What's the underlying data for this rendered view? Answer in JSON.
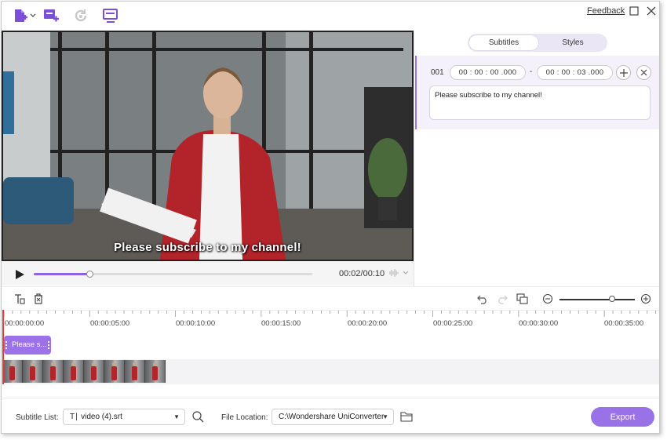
{
  "toolbar": {
    "icons": [
      "add-file-icon",
      "add-subtitle-icon",
      "refresh-icon",
      "screen-icon"
    ],
    "feedback_label": "Feedback"
  },
  "video": {
    "subtitle_text": "Please subscribe to my channel!"
  },
  "player": {
    "current_time": "00:02",
    "total_time": "00:10",
    "time_readout": "00:02/00:10",
    "progress_fraction": 0.2
  },
  "panel": {
    "tabs": [
      {
        "label": "Subtitles",
        "active": true
      },
      {
        "label": "Styles",
        "active": false
      }
    ],
    "subtitle_item": {
      "index": "001",
      "start_time": "00 : 00 : 00 .000",
      "separator": "-",
      "end_time": "00 : 00 : 03 .000",
      "text": "Please subscribe to my channel!"
    }
  },
  "timeline": {
    "ruler_labels": [
      "00:00:00:00",
      "00:00:05:00",
      "00:00:10:00",
      "00:00:15:00",
      "00:00:20:00",
      "00:00:25:00",
      "00:00:30:00",
      "00:00:35:00"
    ],
    "clip_label": "Please s...",
    "zoom_level_fraction": 0.7,
    "thumbnail_count": 8
  },
  "bottom": {
    "subtitle_list_label": "Subtitle List:",
    "subtitle_file": "video (4).srt",
    "file_location_label": "File Location:",
    "file_location": "C:\\Wondershare UniConverter",
    "export_label": "Export"
  },
  "colors": {
    "accent": "#9a72e7",
    "toolbar_icon": "#7b4fd8",
    "playhead": "#e23b3b"
  }
}
